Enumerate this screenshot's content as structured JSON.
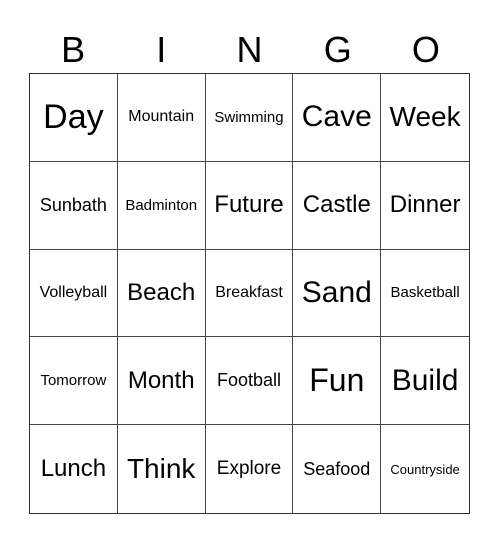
{
  "header": [
    "B",
    "I",
    "N",
    "G",
    "O"
  ],
  "cells": [
    [
      {
        "text": "Day",
        "size": 34
      },
      {
        "text": "Mountain",
        "size": 16
      },
      {
        "text": "Swimming",
        "size": 15
      },
      {
        "text": "Cave",
        "size": 30
      },
      {
        "text": "Week",
        "size": 28
      }
    ],
    [
      {
        "text": "Sunbath",
        "size": 18
      },
      {
        "text": "Badminton",
        "size": 15
      },
      {
        "text": "Future",
        "size": 24
      },
      {
        "text": "Castle",
        "size": 24
      },
      {
        "text": "Dinner",
        "size": 24
      }
    ],
    [
      {
        "text": "Volleyball",
        "size": 16
      },
      {
        "text": "Beach",
        "size": 24
      },
      {
        "text": "Breakfast",
        "size": 16
      },
      {
        "text": "Sand",
        "size": 30
      },
      {
        "text": "Basketball",
        "size": 15
      }
    ],
    [
      {
        "text": "Tomorrow",
        "size": 15
      },
      {
        "text": "Month",
        "size": 24
      },
      {
        "text": "Football",
        "size": 18
      },
      {
        "text": "Fun",
        "size": 32
      },
      {
        "text": "Build",
        "size": 30
      }
    ],
    [
      {
        "text": "Lunch",
        "size": 24
      },
      {
        "text": "Think",
        "size": 28
      },
      {
        "text": "Explore",
        "size": 19
      },
      {
        "text": "Seafood",
        "size": 18
      },
      {
        "text": "Countryside",
        "size": 13
      }
    ]
  ]
}
